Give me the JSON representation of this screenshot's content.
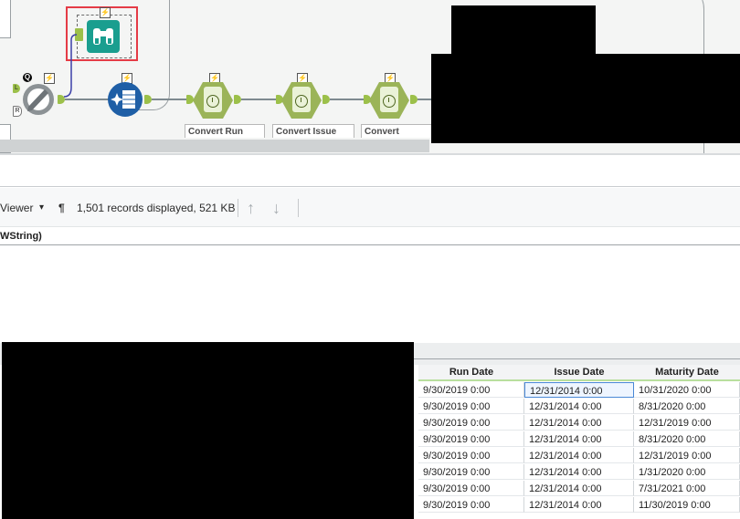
{
  "canvas": {
    "labels": [
      "Convert Run",
      "Convert Issue",
      "Convert"
    ],
    "anchor_letters": {
      "q": "Q",
      "l": "L",
      "r": "R"
    },
    "bolt_glyph": "⚡"
  },
  "toolbar": {
    "view_label": "Viewer",
    "dropdown_glyph": "▾",
    "pilcrow_glyph": "¶",
    "records_text": "1,501 records displayed, 521 KB",
    "up_glyph": "↑",
    "down_glyph": "↓"
  },
  "field_header": "WString)",
  "table": {
    "columns": [
      "Run Date",
      "Issue Date",
      "Maturity Date"
    ],
    "rows": [
      [
        "9/30/2019 0:00",
        "12/31/2014 0:00",
        "10/31/2020 0:00"
      ],
      [
        "9/30/2019 0:00",
        "12/31/2014 0:00",
        "8/31/2020 0:00"
      ],
      [
        "9/30/2019 0:00",
        "12/31/2014 0:00",
        "12/31/2019 0:00"
      ],
      [
        "9/30/2019 0:00",
        "12/31/2014 0:00",
        "8/31/2020 0:00"
      ],
      [
        "9/30/2019 0:00",
        "12/31/2014 0:00",
        "12/31/2019 0:00"
      ],
      [
        "9/30/2019 0:00",
        "12/31/2014 0:00",
        "1/31/2020 0:00"
      ],
      [
        "9/30/2019 0:00",
        "12/31/2014 0:00",
        "7/31/2021 0:00"
      ],
      [
        "9/30/2019 0:00",
        "12/31/2014 0:00",
        "11/30/2019 0:00"
      ]
    ]
  },
  "colors": {
    "accent_green": "#9bb458",
    "browse_teal": "#1a9e8f",
    "highlight_red": "#e53b46"
  }
}
